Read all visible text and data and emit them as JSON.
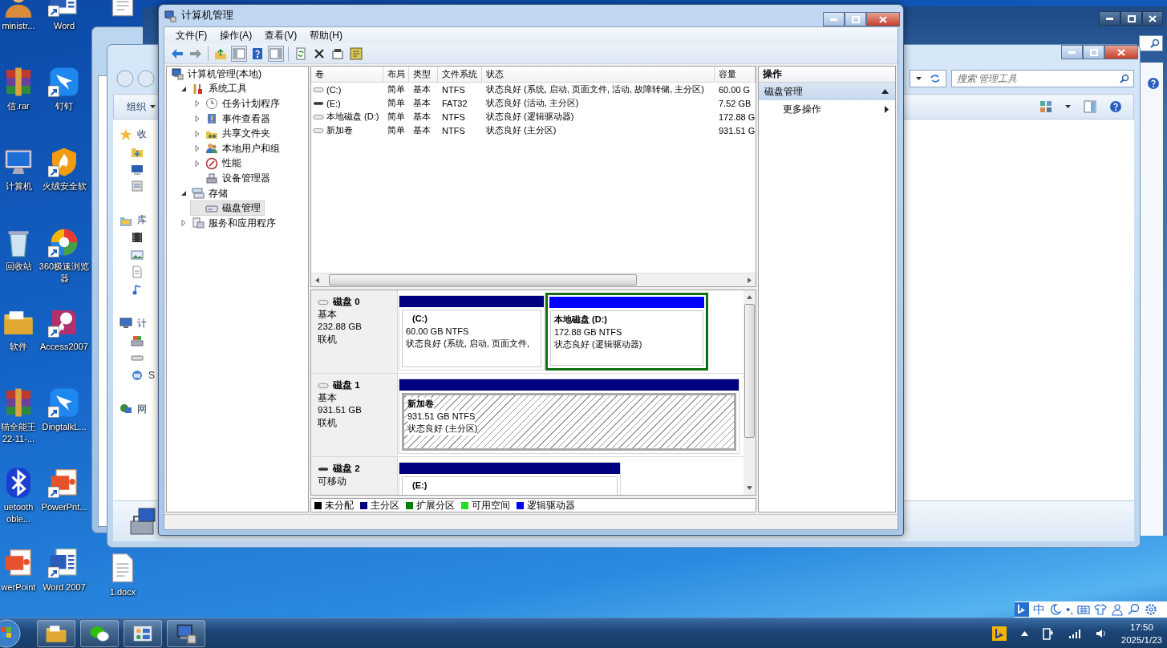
{
  "desktop": {
    "columns": [
      [
        {
          "label": "ministr...",
          "kind": "user",
          "shortcut": false
        },
        {
          "label": "信.rar",
          "kind": "archive",
          "shortcut": false
        },
        {
          "label": "计算机",
          "kind": "computer",
          "shortcut": false
        },
        {
          "label": "回收站",
          "kind": "recycle",
          "shortcut": false
        },
        {
          "label": "软件",
          "kind": "folder",
          "shortcut": false
        },
        {
          "label": "猫全能王 22-11-...",
          "kind": "archive",
          "shortcut": false
        },
        {
          "label": "uetooth oble...",
          "kind": "bluetooth",
          "shortcut": false
        },
        {
          "label": "werPoint",
          "kind": "slides",
          "shortcut": false
        }
      ],
      [
        {
          "label": "Word",
          "kind": "word",
          "shortcut": true
        },
        {
          "label": "钉钉",
          "kind": "wing",
          "shortcut": true
        },
        {
          "label": "火绒安全软",
          "kind": "shield",
          "shortcut": true
        },
        {
          "label": "360极速浏览器",
          "kind": "browser",
          "shortcut": true
        },
        {
          "label": "Access2007",
          "kind": "key",
          "shortcut": true
        },
        {
          "label": "DingtalkL...",
          "kind": "wing",
          "shortcut": true
        },
        {
          "label": "PowerPnt...",
          "kind": "slides",
          "shortcut": true
        },
        {
          "label": "Word 2007",
          "kind": "word",
          "shortcut": true
        }
      ],
      [
        {
          "kind": "doc",
          "shortcut": false
        },
        {
          "label": "1.docx",
          "kind": "doc",
          "shortcut": false
        }
      ]
    ]
  },
  "explorer_window": {
    "organize": "组织",
    "search_placeholder": "搜索 管理工具",
    "nav": [
      {
        "label": "收",
        "kind": "star",
        "children": [
          {
            "kind": "download"
          },
          {
            "kind": "desktop"
          },
          {
            "kind": "recent"
          }
        ]
      },
      {
        "label": "库",
        "kind": "library",
        "children": [
          {
            "kind": "video"
          },
          {
            "kind": "picture"
          },
          {
            "kind": "docsmall"
          },
          {
            "kind": "music"
          }
        ]
      },
      {
        "label": "计",
        "kind": "mycomputer",
        "children": [
          {
            "kind": "windrive"
          },
          {
            "kind": "drive"
          },
          {
            "label": "S",
            "kind": "netdrive"
          }
        ]
      },
      {
        "label": "网",
        "kind": "network"
      }
    ]
  },
  "main_window": {
    "title": "计算机管理",
    "menu": [
      "文件(F)",
      "操作(A)",
      "查看(V)",
      "帮助(H)"
    ],
    "toolbar": [
      {
        "kind": "back",
        "on": false
      },
      {
        "kind": "forward",
        "on": false
      },
      {
        "kind": "up",
        "on": false
      },
      {
        "kind": "tree-pane",
        "on": true
      },
      {
        "kind": "help",
        "on": false
      },
      {
        "kind": "action-pane",
        "on": true
      },
      {
        "kind": "refresh",
        "on": false
      },
      {
        "kind": "delete",
        "on": false
      },
      {
        "kind": "properties",
        "on": false
      },
      {
        "kind": "list",
        "on": false
      }
    ],
    "tree": [
      {
        "label": "计算机管理(本地)",
        "kind": "mgmt",
        "selected": false,
        "children": [
          {
            "label": "系统工具",
            "kind": "tools",
            "expanded": true,
            "selected": false,
            "children": [
              {
                "label": "任务计划程序",
                "kind": "clock",
                "expanded": false,
                "selected": false
              },
              {
                "label": "事件查看器",
                "kind": "event",
                "expanded": false,
                "selected": false
              },
              {
                "label": "共享文件夹",
                "kind": "share",
                "expanded": false,
                "selected": false
              },
              {
                "label": "本地用户和组",
                "kind": "users",
                "expanded": false,
                "selected": false
              },
              {
                "label": "性能",
                "kind": "performance",
                "expanded": false,
                "selected": false
              },
              {
                "label": "设备管理器",
                "kind": "device",
                "selected": false
              }
            ]
          },
          {
            "label": "存储",
            "kind": "storage",
            "expanded": true,
            "selected": false,
            "children": [
              {
                "label": "磁盘管理",
                "kind": "disk",
                "selected": true
              }
            ]
          },
          {
            "label": "服务和应用程序",
            "kind": "services",
            "expanded": false,
            "selected": false
          }
        ]
      }
    ],
    "volumes": {
      "columns": [
        "卷",
        "布局",
        "类型",
        "文件系统",
        "状态",
        "容量"
      ],
      "rows": [
        {
          "kind": "fixed",
          "cells": [
            "(C:)",
            "简单",
            "基本",
            "NTFS",
            "状态良好 (系统, 启动, 页面文件, 活动, 故障转储, 主分区)",
            "60.00 G"
          ]
        },
        {
          "kind": "removable",
          "cells": [
            "(E:)",
            "简单",
            "基本",
            "FAT32",
            "状态良好 (活动, 主分区)",
            "7.52 GB"
          ]
        },
        {
          "kind": "fixed",
          "cells": [
            "本地磁盘 (D:)",
            "简单",
            "基本",
            "NTFS",
            "状态良好 (逻辑驱动器)",
            "172.88 G"
          ]
        },
        {
          "kind": "fixed",
          "cells": [
            "新加卷",
            "简单",
            "基本",
            "NTFS",
            "状态良好 (主分区)",
            "931.51 G"
          ]
        }
      ]
    },
    "disks": [
      {
        "name": "磁盘 0",
        "kind": "fixed",
        "type": "基本",
        "size": "232.88 GB",
        "status": "联机",
        "partitions": [
          {
            "kind": "primary",
            "selected": false,
            "label": "(C:)",
            "detail": "60.00 GB NTFS",
            "status": "状态良好 (系统, 启动, 页面文件,"
          },
          {
            "kind": "logical",
            "selected": false,
            "label": "本地磁盘  (D:)",
            "detail": "172.88 GB NTFS",
            "status": "状态良好 (逻辑驱动器)"
          }
        ]
      },
      {
        "name": "磁盘 1",
        "kind": "fixed",
        "type": "基本",
        "size": "931.51 GB",
        "status": "联机",
        "partitions": [
          {
            "kind": "primary",
            "selected": true,
            "label": "新加卷",
            "detail": "931.51 GB NTFS",
            "status": "状态良好 (主分区)"
          }
        ]
      },
      {
        "name": "磁盘 2",
        "kind": "removable",
        "type": "可移动",
        "partitions": [
          {
            "kind": "primary",
            "selected": false,
            "label": "(E:)"
          }
        ]
      }
    ],
    "legend": [
      {
        "label": "未分配",
        "color": "#000000"
      },
      {
        "label": "主分区",
        "color": "#000080"
      },
      {
        "label": "扩展分区",
        "color": "#008000"
      },
      {
        "label": "可用空间",
        "color": "#22dd22"
      },
      {
        "label": "逻辑驱动器",
        "color": "#0000ff"
      }
    ],
    "actions": {
      "title": "操作",
      "section": "磁盘管理",
      "items": [
        "更多操作"
      ]
    }
  },
  "taskbar": {
    "buttons": [
      {
        "kind": "folder"
      },
      {
        "kind": "chat"
      },
      {
        "kind": "control-panel"
      },
      {
        "kind": "mgmt"
      }
    ],
    "time": "17:50",
    "date": "2025/1/23"
  },
  "ime": {
    "mode": "中",
    "punctuation": "•,"
  }
}
